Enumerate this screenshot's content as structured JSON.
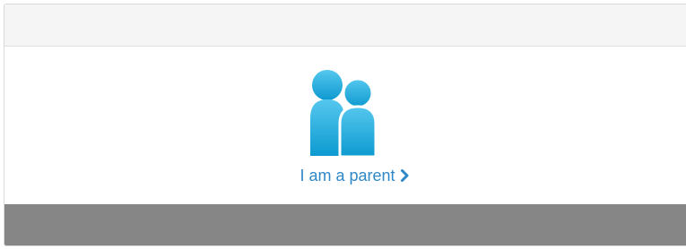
{
  "parent_option": {
    "label": "I am a parent",
    "icon": "parent-icon",
    "chevron_icon": "chevron-right-icon",
    "colors": {
      "link": "#2f88c8",
      "icon_top": "#55c7ee",
      "icon_bottom": "#0d9ad0",
      "footer": "#868686",
      "header": "#f5f5f5"
    }
  }
}
